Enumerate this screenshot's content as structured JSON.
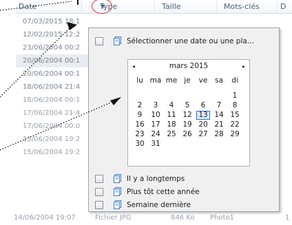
{
  "header": {
    "columns": [
      {
        "label": "Date"
      },
      {
        "label": "Type"
      },
      {
        "label": "Taille"
      },
      {
        "label": "Mots-clés"
      },
      {
        "label": "D"
      }
    ]
  },
  "list": {
    "dates": [
      "07/03/2015 18:1",
      "12/02/2015 12:2",
      "23/06/2004 00:2",
      "20/06/2004 00:1",
      "20/06/2004 00:1",
      "18/06/2004 21:4",
      "18/06/2004 00:1",
      "17/06/2004 21:4",
      "17/06/2004 00:0",
      "15/06/2004 19:2",
      "15/06/2004 19:2"
    ],
    "last_row": {
      "date": "14/06/2004 19:07",
      "type": "Fichier JPG",
      "size": "846 Ko",
      "keywords": "Photo1",
      "extra": "1"
    }
  },
  "popup": {
    "top_item": "Sélectionner une date ou une pla...",
    "items": [
      "Il y a longtemps",
      "Plus tôt cette année",
      "Semaine dernière"
    ],
    "calendar": {
      "prev_icon": "◂",
      "next_icon": "▸",
      "title": "mars 2015",
      "weekdays": [
        "lu",
        "ma",
        "me",
        "je",
        "ve",
        "sa",
        "di"
      ],
      "weeks": [
        [
          "",
          "",
          "",
          "",
          "",
          "",
          "1"
        ],
        [
          "2",
          "3",
          "4",
          "5",
          "6",
          "7",
          "8"
        ],
        [
          "9",
          "10",
          "11",
          "12",
          "13",
          "14",
          "15"
        ],
        [
          "16",
          "17",
          "18",
          "19",
          "20",
          "21",
          "22"
        ],
        [
          "23",
          "24",
          "25",
          "26",
          "27",
          "28",
          "29"
        ],
        [
          "30",
          "31",
          "",
          "",
          "",
          "",
          ""
        ]
      ],
      "today": "13"
    }
  },
  "colors": {
    "highlight_circle": "#e22a2a",
    "today_border": "#2b73c8"
  }
}
